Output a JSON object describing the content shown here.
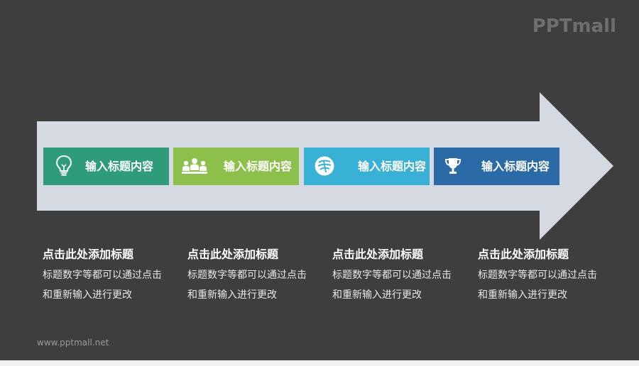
{
  "brand": {
    "logo_text": "PPTmall",
    "footer_url": "www.pptmall.net"
  },
  "colors": {
    "background": "#3e3e3e",
    "arrow": "#d5d9e2",
    "step1": "#2e9b7b",
    "step2": "#8cc04b",
    "step3": "#39b0d5",
    "step4": "#2a6aa7"
  },
  "steps": [
    {
      "label": "输入标题内容",
      "icon": "lightbulb-icon"
    },
    {
      "label": "输入标题内容",
      "icon": "people-icon"
    },
    {
      "label": "输入标题内容",
      "icon": "lettuce-icon"
    },
    {
      "label": "输入标题内容",
      "icon": "trophy-icon"
    }
  ],
  "captions": [
    {
      "title": "点击此处添加标题",
      "desc": "标题数字等都可以通过点击和重新输入进行更改"
    },
    {
      "title": "点击此处添加标题",
      "desc": "标题数字等都可以通过点击和重新输入进行更改"
    },
    {
      "title": "点击此处添加标题",
      "desc": "标题数字等都可以通过点击和重新输入进行更改"
    },
    {
      "title": "点击此处添加标题",
      "desc": "标题数字等都可以通过点击和重新输入进行更改"
    }
  ]
}
